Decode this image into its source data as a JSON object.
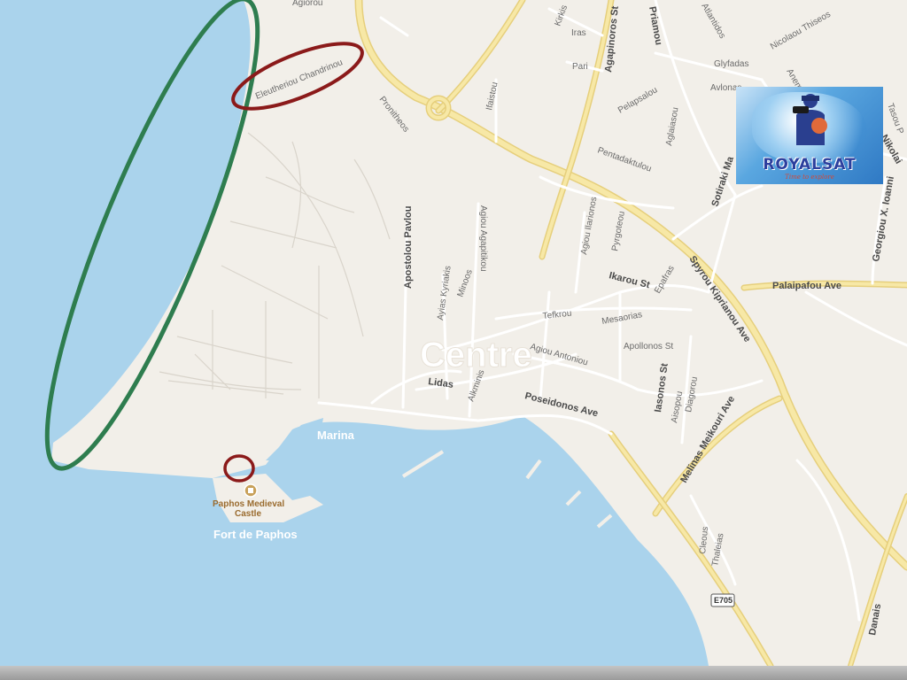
{
  "map": {
    "area_label": "Centre",
    "marina_label": "Marina",
    "fort_label": "Fort de Paphos",
    "poi": {
      "line1": "Paphos Medieval",
      "line2": "Castle"
    },
    "highway_shield": "E705",
    "streets": {
      "agiorou": "Agiorou",
      "eleutheriou": "Eleutheriou Chandrinou",
      "pronitheos": "Pronitheos",
      "ifaistou": "Ifaistou",
      "kirkis": "Kirkis",
      "iras": "Iras",
      "pari": "Pari",
      "agapinoros": "Agapinoros St",
      "pridmou": "Priamou",
      "atlantidos": "Atlantidos",
      "glyfadas": "Glyfadas",
      "avlonas": "Avlonas",
      "nicolaou_thiseos": "Nicolaou Thiseos",
      "anemon": "Anemon",
      "tasou": "Tasou P",
      "nikos_nikolai": "Nikos Nikolai",
      "pelapsalou": "Pelapsalou",
      "aglaiasou": "Aglaiasou",
      "pentadaktulou": "Pentadaktulou",
      "sotiraki": "Sotiraki Ma",
      "georgiou": "Georgiou X. Ioanni",
      "apostolou_pavlou": "Apostolou Pavlou",
      "agiou_agapitikou": "Agiou Agapitikou",
      "agiou_ilarionos": "Agiou Ilarionos",
      "pyrgoteou": "Pyrgoteou",
      "spyrou": "Spyrou Kiprianou Ave",
      "palaipafou": "Palaipafou Ave",
      "ayias_kyriakis": "Ayias Kyriakis",
      "minoos": "Minoos",
      "ikarou": "Ikarou St",
      "epafras": "Epafras",
      "tefkrou": "Tefkrou",
      "mesaorias": "Mesaorias",
      "apollonos": "Apollonos St",
      "agiou_antoniou": "Agiou Antoniou",
      "lidas": "Lidas",
      "alkminis": "Alkminis",
      "poseidonos": "Poseidonos Ave",
      "iasonos": "Iasonos St",
      "aisopou": "Aisopou",
      "diagorou": "Diagorou",
      "melinas": "Melinas Meikouri Ave",
      "cleous": "Cleous",
      "thaleias": "Thaleias",
      "danais": "Danais"
    }
  },
  "logo": {
    "title": "ROYALSAT",
    "tagline": "Time to explore"
  },
  "colors": {
    "land": "#f2efe9",
    "water": "#aad3ec",
    "road_major": "#f7e8a6",
    "road_major_edge": "#e6cf7c",
    "road_minor": "#ffffff",
    "highlight_green": "#2e7d4f",
    "highlight_red": "#8b1a1a"
  }
}
